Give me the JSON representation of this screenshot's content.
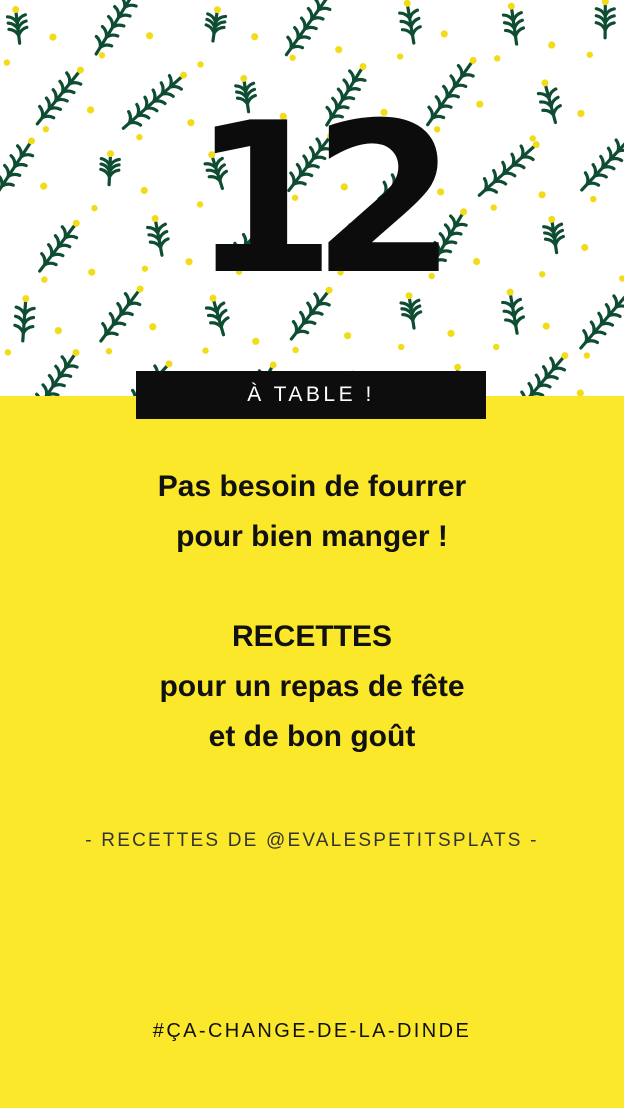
{
  "hero": {
    "number": "12",
    "tag": "À TABLE !"
  },
  "headline": {
    "line1": "Pas besoin de fourrer",
    "line2": "pour bien manger !",
    "line3": "RECETTES",
    "line4": "pour un repas de fête",
    "line5": "et de bon goût"
  },
  "credit": "- RECETTES DE @EVALESPETITSPLATS -",
  "hashtag": "#ÇA-CHANGE-DE-LA-DINDE",
  "colors": {
    "background_yellow": "#fbe82b",
    "leaf_green": "#0e4d32",
    "berry_yellow": "#f2dc1a",
    "text_black": "#111111"
  }
}
